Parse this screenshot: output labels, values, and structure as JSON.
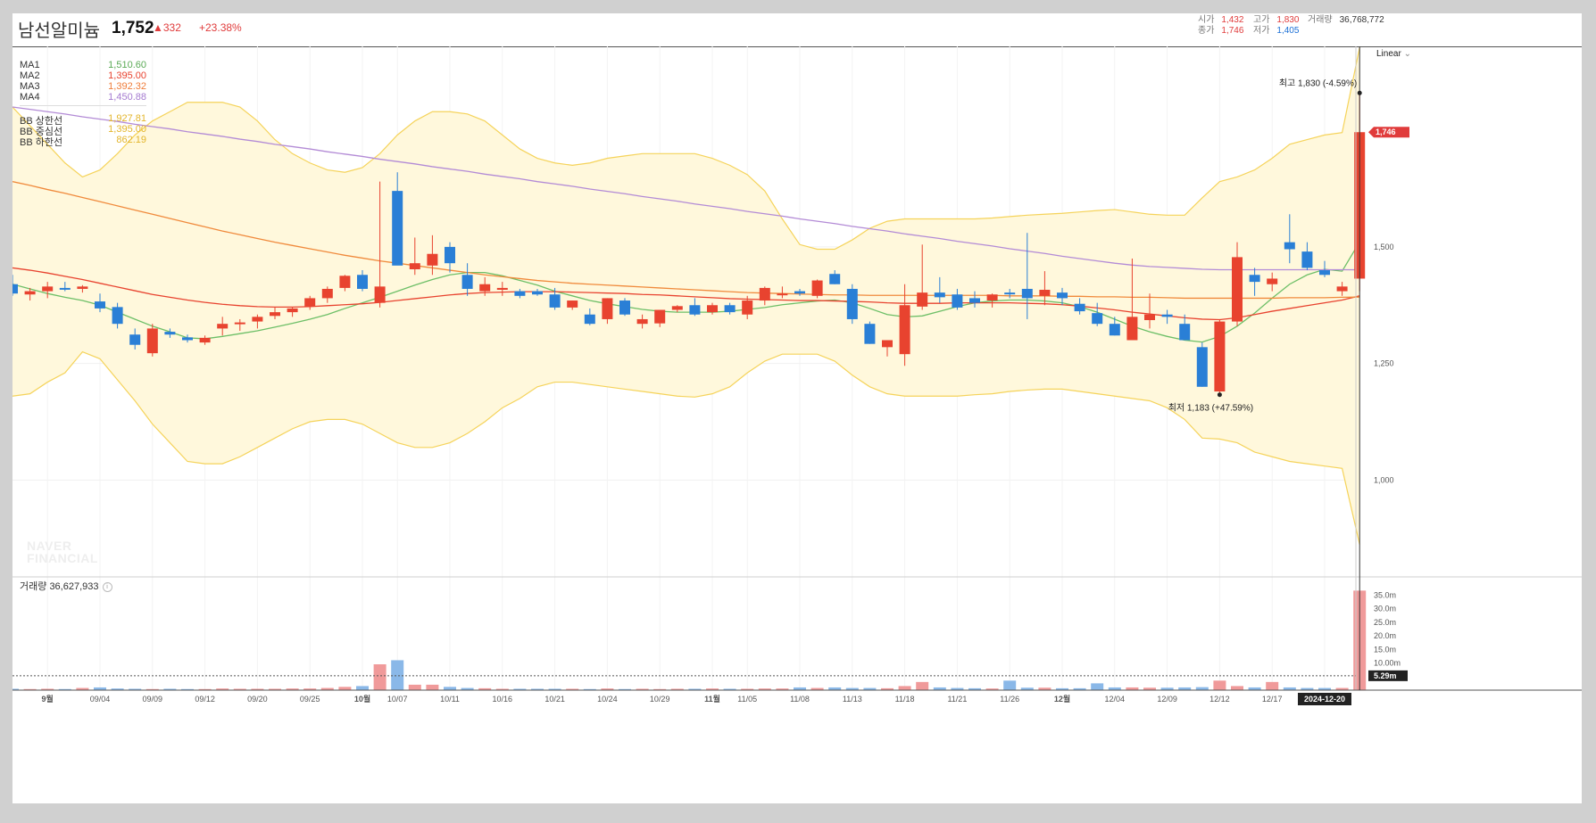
{
  "header": {
    "stock_name": "남선알미늄",
    "price": "1,752",
    "change": "▲332",
    "change_pct": "+23.38%",
    "open_label": "시가",
    "open": "1,432",
    "high_label": "고가",
    "high": "1,830",
    "volume_label": "거래량",
    "volume": "36,768,772",
    "close_label": "종가",
    "close": "1,746",
    "low_label": "저가",
    "low": "1,405"
  },
  "scale_button": "Linear",
  "legend": {
    "ma1_label": "MA1",
    "ma1_value": "1,510.60",
    "ma2_label": "MA2",
    "ma2_value": "1,395.00",
    "ma3_label": "MA3",
    "ma3_value": "1,392.32",
    "ma4_label": "MA4",
    "ma4_value": "1,450.88",
    "bb_upper_label": "BB 상한선",
    "bb_upper_value": "1,927.81",
    "bb_mid_label": "BB 중심선",
    "bb_mid_value": "1,395.00",
    "bb_lower_label": "BB 하한선",
    "bb_lower_value": "862.19"
  },
  "volume_panel": {
    "label": "거래량",
    "value": "36,627,933"
  },
  "watermark": [
    "NAVER",
    "FINANCIAL"
  ],
  "colors": {
    "up": "#e8432f",
    "down": "#2a7fd6",
    "ma1": "#6dbf67",
    "ma2": "#e8432f",
    "ma3": "#f08a3c",
    "ma4": "#b38bd6",
    "bb": "#f5d35a",
    "bb_fill": "#fff8dc"
  },
  "chart_data": {
    "type": "candlestick",
    "price_axis": {
      "ylim": [
        800,
        1930
      ],
      "ticks": [
        1000,
        1250,
        1500
      ],
      "tick_labels": [
        "1,000",
        "1,250",
        "1,500"
      ],
      "current_label": "1,746"
    },
    "volume_axis": {
      "ylim": [
        0,
        40
      ],
      "ticks": [
        10,
        15,
        20,
        25,
        30,
        35
      ],
      "tick_labels": [
        "10.00m",
        "15.0m",
        "20.0m",
        "25.0m",
        "30.0m",
        "35.0m"
      ],
      "reference_label": "5.29m",
      "reference_value": 5.29
    },
    "x_tick_labels": [
      "9월",
      "09/04",
      "09/09",
      "09/12",
      "09/20",
      "09/25",
      "10월",
      "10/07",
      "10/11",
      "10/16",
      "10/21",
      "10/24",
      "10/29",
      "11월",
      "11/05",
      "11/08",
      "11/13",
      "11/18",
      "11/21",
      "11/26",
      "12월",
      "12/04",
      "12/09",
      "12/12",
      "12/17",
      "2024-12-20"
    ],
    "x_tick_index": [
      2,
      5,
      8,
      11,
      14,
      17,
      20,
      22,
      25,
      28,
      31,
      34,
      37,
      40,
      42,
      45,
      48,
      51,
      54,
      57,
      60,
      63,
      66,
      69,
      72,
      75
    ],
    "annotations": {
      "high": "최고 1,830 (-4.59%)",
      "low": "최저 1,183 (+47.59%)"
    },
    "candles": [
      [
        1420,
        1440,
        1395,
        1400
      ],
      [
        1398,
        1412,
        1385,
        1405
      ],
      [
        1405,
        1425,
        1390,
        1415
      ],
      [
        1412,
        1425,
        1405,
        1410
      ],
      [
        1410,
        1418,
        1402,
        1415
      ],
      [
        1383,
        1400,
        1360,
        1368
      ],
      [
        1371,
        1380,
        1325,
        1335
      ],
      [
        1312,
        1325,
        1280,
        1290
      ],
      [
        1272,
        1335,
        1265,
        1325
      ],
      [
        1318,
        1325,
        1305,
        1312
      ],
      [
        1306,
        1312,
        1295,
        1300
      ],
      [
        1295,
        1310,
        1290,
        1305
      ],
      [
        1325,
        1350,
        1310,
        1335
      ],
      [
        1335,
        1345,
        1320,
        1338
      ],
      [
        1340,
        1355,
        1325,
        1350
      ],
      [
        1352,
        1370,
        1345,
        1360
      ],
      [
        1360,
        1370,
        1350,
        1368
      ],
      [
        1372,
        1395,
        1365,
        1390
      ],
      [
        1390,
        1415,
        1380,
        1410
      ],
      [
        1412,
        1440,
        1405,
        1438
      ],
      [
        1440,
        1450,
        1405,
        1410
      ],
      [
        1380,
        1640,
        1370,
        1415
      ],
      [
        1620,
        1660,
        1590,
        1460
      ],
      [
        1452,
        1520,
        1440,
        1465
      ],
      [
        1460,
        1525,
        1440,
        1485
      ],
      [
        1500,
        1510,
        1445,
        1465
      ],
      [
        1440,
        1465,
        1395,
        1410
      ],
      [
        1405,
        1435,
        1395,
        1420
      ],
      [
        1408,
        1425,
        1395,
        1412
      ],
      [
        1405,
        1410,
        1390,
        1395
      ],
      [
        1405,
        1410,
        1395,
        1398
      ],
      [
        1398,
        1412,
        1365,
        1370
      ],
      [
        1370,
        1385,
        1365,
        1385
      ],
      [
        1355,
        1368,
        1332,
        1335
      ],
      [
        1345,
        1390,
        1335,
        1390
      ],
      [
        1385,
        1390,
        1352,
        1355
      ],
      [
        1335,
        1355,
        1325,
        1345
      ],
      [
        1336,
        1365,
        1328,
        1365
      ],
      [
        1365,
        1375,
        1360,
        1373
      ],
      [
        1375,
        1390,
        1352,
        1355
      ],
      [
        1360,
        1380,
        1355,
        1375
      ],
      [
        1375,
        1380,
        1355,
        1360
      ],
      [
        1355,
        1395,
        1345,
        1385
      ],
      [
        1385,
        1415,
        1375,
        1412
      ],
      [
        1398,
        1415,
        1390,
        1400
      ],
      [
        1405,
        1410,
        1395,
        1400
      ],
      [
        1395,
        1430,
        1390,
        1428
      ],
      [
        1442,
        1450,
        1420,
        1420
      ],
      [
        1410,
        1420,
        1335,
        1345
      ],
      [
        1335,
        1340,
        1292,
        1292
      ],
      [
        1285,
        1295,
        1265,
        1300
      ],
      [
        1270,
        1420,
        1245,
        1375
      ],
      [
        1372,
        1505,
        1365,
        1402
      ],
      [
        1402,
        1435,
        1380,
        1392
      ],
      [
        1398,
        1410,
        1365,
        1370
      ],
      [
        1390,
        1405,
        1370,
        1380
      ],
      [
        1385,
        1400,
        1370,
        1398
      ],
      [
        1402,
        1410,
        1390,
        1400
      ],
      [
        1410,
        1530,
        1345,
        1390
      ],
      [
        1395,
        1448,
        1375,
        1408
      ],
      [
        1402,
        1412,
        1375,
        1390
      ],
      [
        1378,
        1390,
        1355,
        1362
      ],
      [
        1358,
        1380,
        1330,
        1335
      ],
      [
        1335,
        1350,
        1310,
        1310
      ],
      [
        1300,
        1475,
        1300,
        1350
      ],
      [
        1343,
        1400,
        1325,
        1355
      ],
      [
        1355,
        1365,
        1335,
        1350
      ],
      [
        1335,
        1355,
        1320,
        1300
      ],
      [
        1285,
        1295,
        1200,
        1200
      ],
      [
        1190,
        1345,
        1183,
        1340
      ],
      [
        1340,
        1510,
        1330,
        1478
      ],
      [
        1440,
        1455,
        1395,
        1425
      ],
      [
        1420,
        1445,
        1405,
        1432
      ],
      [
        1510,
        1570,
        1465,
        1495
      ],
      [
        1490,
        1510,
        1450,
        1455
      ],
      [
        1450,
        1470,
        1435,
        1440
      ],
      [
        1405,
        1425,
        1395,
        1415
      ],
      [
        1432,
        1830,
        1405,
        1746
      ]
    ],
    "ma_series": [
      {
        "name": "MA1",
        "values": [
          1420,
          1410,
          1400,
          1392,
          1385,
          1375,
          1360,
          1345,
          1330,
          1318,
          1305,
          1303,
          1308,
          1314,
          1320,
          1328,
          1336,
          1345,
          1355,
          1368,
          1380,
          1392,
          1405,
          1418,
          1430,
          1440,
          1445,
          1445,
          1438,
          1428,
          1418,
          1405,
          1395,
          1385,
          1378,
          1372,
          1366,
          1362,
          1360,
          1360,
          1360,
          1362,
          1366,
          1370,
          1376,
          1380,
          1384,
          1386,
          1380,
          1368,
          1355,
          1350,
          1352,
          1362,
          1372,
          1380,
          1384,
          1386,
          1386,
          1384,
          1380,
          1372,
          1360,
          1345,
          1330,
          1318,
          1308,
          1300,
          1296,
          1308,
          1330,
          1358,
          1390,
          1420,
          1440,
          1452,
          1448,
          1510.6
        ]
      },
      {
        "name": "MA2",
        "values": [
          1455,
          1450,
          1444,
          1437,
          1430,
          1422,
          1414,
          1406,
          1398,
          1392,
          1386,
          1381,
          1377,
          1374,
          1372,
          1371,
          1371,
          1372,
          1374,
          1376,
          1378,
          1381,
          1385,
          1389,
          1393,
          1397,
          1400,
          1402,
          1403,
          1404,
          1404,
          1404,
          1403,
          1402,
          1401,
          1400,
          1398,
          1397,
          1395,
          1393,
          1391,
          1389,
          1388,
          1387,
          1386,
          1385,
          1385,
          1384,
          1383,
          1382,
          1380,
          1379,
          1379,
          1379,
          1380,
          1380,
          1380,
          1380,
          1379,
          1378,
          1376,
          1373,
          1369,
          1365,
          1360,
          1356,
          1352,
          1348,
          1345,
          1344,
          1348,
          1355,
          1362,
          1368,
          1374,
          1380,
          1386,
          1395
        ]
      },
      {
        "name": "MA3",
        "values": [
          1640,
          1632,
          1623,
          1615,
          1606,
          1597,
          1588,
          1579,
          1570,
          1561,
          1552,
          1543,
          1534,
          1526,
          1518,
          1510,
          1503,
          1496,
          1489,
          1482,
          1476,
          1470,
          1465,
          1460,
          1455,
          1450,
          1445,
          1440,
          1436,
          1432,
          1428,
          1425,
          1422,
          1420,
          1418,
          1416,
          1414,
          1412,
          1410,
          1408,
          1406,
          1404,
          1402,
          1401,
          1400,
          1399,
          1398,
          1397,
          1397,
          1396,
          1396,
          1396,
          1396,
          1396,
          1396,
          1396,
          1396,
          1395,
          1395,
          1395,
          1394,
          1394,
          1393,
          1393,
          1392,
          1392,
          1391,
          1390,
          1390,
          1390,
          1390,
          1390,
          1390,
          1391,
          1391,
          1391,
          1392,
          1392.32
        ]
      },
      {
        "name": "MA4",
        "values": [
          1800,
          1795,
          1790,
          1785,
          1779,
          1774,
          1769,
          1763,
          1758,
          1753,
          1747,
          1742,
          1737,
          1731,
          1726,
          1720,
          1715,
          1710,
          1704,
          1699,
          1694,
          1688,
          1683,
          1678,
          1672,
          1667,
          1662,
          1656,
          1651,
          1646,
          1640,
          1635,
          1630,
          1624,
          1619,
          1614,
          1608,
          1603,
          1598,
          1592,
          1587,
          1582,
          1576,
          1571,
          1566,
          1560,
          1555,
          1550,
          1544,
          1539,
          1534,
          1528,
          1523,
          1518,
          1512,
          1507,
          1502,
          1496,
          1491,
          1486,
          1480,
          1475,
          1470,
          1465,
          1461,
          1458,
          1456,
          1454,
          1452,
          1451,
          1451,
          1451,
          1451,
          1451,
          1451,
          1451,
          1451,
          1450.88
        ]
      }
    ],
    "bollinger": {
      "upper": [
        1800,
        1760,
        1720,
        1680,
        1650,
        1665,
        1700,
        1740,
        1770,
        1790,
        1810,
        1810,
        1810,
        1800,
        1770,
        1730,
        1700,
        1680,
        1665,
        1660,
        1670,
        1700,
        1740,
        1770,
        1790,
        1790,
        1785,
        1770,
        1740,
        1710,
        1690,
        1680,
        1675,
        1680,
        1690,
        1695,
        1700,
        1700,
        1700,
        1700,
        1690,
        1675,
        1655,
        1620,
        1560,
        1505,
        1495,
        1495,
        1515,
        1540,
        1555,
        1560,
        1560,
        1560,
        1560,
        1560,
        1562,
        1565,
        1568,
        1570,
        1572,
        1575,
        1578,
        1580,
        1575,
        1570,
        1568,
        1568,
        1605,
        1640,
        1650,
        1665,
        1690,
        1720,
        1730,
        1740,
        1745,
        1927.81
      ],
      "lower": [
        1180,
        1185,
        1210,
        1230,
        1275,
        1260,
        1215,
        1170,
        1120,
        1080,
        1040,
        1035,
        1035,
        1050,
        1070,
        1090,
        1110,
        1125,
        1130,
        1130,
        1120,
        1100,
        1080,
        1070,
        1070,
        1080,
        1100,
        1125,
        1155,
        1175,
        1200,
        1210,
        1210,
        1205,
        1200,
        1195,
        1190,
        1185,
        1180,
        1178,
        1185,
        1200,
        1230,
        1255,
        1270,
        1270,
        1270,
        1255,
        1225,
        1200,
        1185,
        1180,
        1180,
        1180,
        1180,
        1183,
        1185,
        1190,
        1193,
        1195,
        1195,
        1190,
        1185,
        1180,
        1175,
        1170,
        1155,
        1130,
        1090,
        1088,
        1080,
        1060,
        1050,
        1040,
        1035,
        1030,
        1025,
        862.19
      ]
    },
    "volumes_m": [
      0.5,
      0.4,
      0.5,
      0.4,
      0.8,
      1.0,
      0.6,
      0.5,
      0.4,
      0.5,
      0.4,
      0.4,
      0.6,
      0.5,
      0.5,
      0.5,
      0.6,
      0.6,
      0.8,
      1.2,
      1.5,
      9.5,
      11.0,
      2.0,
      2.0,
      1.2,
      0.8,
      0.7,
      0.5,
      0.5,
      0.5,
      0.5,
      0.5,
      0.4,
      0.6,
      0.4,
      0.5,
      0.4,
      0.5,
      0.5,
      0.6,
      0.5,
      0.5,
      0.6,
      0.6,
      1.0,
      0.8,
      1.0,
      0.8,
      0.8,
      0.7,
      1.5,
      3.0,
      1.0,
      0.8,
      0.7,
      0.6,
      3.5,
      0.9,
      0.9,
      0.7,
      0.7,
      2.5,
      1.0,
      1.0,
      0.9,
      0.9,
      1.0,
      1.1,
      3.5,
      1.5,
      1.0,
      3.0,
      1.0,
      0.8,
      0.8,
      0.8,
      36.6
    ]
  }
}
